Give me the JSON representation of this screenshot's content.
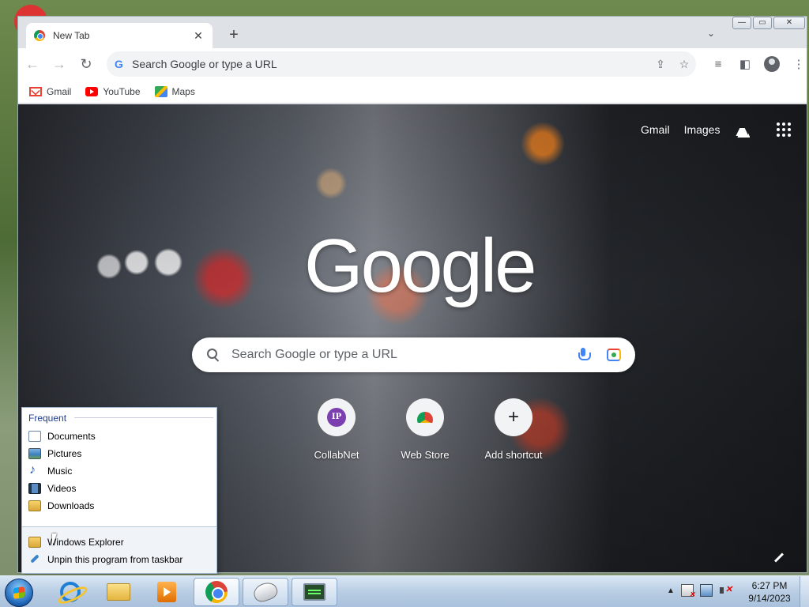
{
  "browser": {
    "tab_title": "New Tab",
    "new_tab_symbol": "+",
    "tab_close_symbol": "✕",
    "tab_menu_symbol": "⌄",
    "omnibox_placeholder": "Search Google or type a URL",
    "window_buttons": {
      "minimize": "—",
      "maximize": "▭",
      "close": "✕"
    }
  },
  "bookmarks": [
    {
      "label": "Gmail",
      "icon": "gmail-icon"
    },
    {
      "label": "YouTube",
      "icon": "youtube-icon"
    },
    {
      "label": "Maps",
      "icon": "maps-icon"
    }
  ],
  "ntp": {
    "top_links": {
      "gmail": "Gmail",
      "images": "Images"
    },
    "logo_text": "Google",
    "search_placeholder": "Search Google or type a URL",
    "shortcuts": [
      {
        "label": "CollabNet",
        "badge": "IP"
      },
      {
        "label": "Web Store"
      },
      {
        "label": "Add shortcut",
        "symbol": "+"
      }
    ]
  },
  "jumplist": {
    "header": "Frequent",
    "frequent": [
      {
        "label": "Documents",
        "icon": "documents-icon"
      },
      {
        "label": "Pictures",
        "icon": "pictures-icon"
      },
      {
        "label": "Music",
        "icon": "music-icon"
      },
      {
        "label": "Videos",
        "icon": "videos-icon"
      },
      {
        "label": "Downloads",
        "icon": "downloads-icon"
      }
    ],
    "tasks": [
      {
        "label": "Windows Explorer",
        "icon": "explorer-icon"
      },
      {
        "label": "Unpin this program from taskbar",
        "icon": "unpin-icon"
      }
    ]
  },
  "taskbar": {
    "tray_up_symbol": "▲",
    "time": "6:27 PM",
    "date": "9/14/2023"
  },
  "colors": {
    "accent_blue": "#4285f4",
    "taskbar_top": "#d9e7f5",
    "jumplist_header": "#1e3c8c"
  }
}
